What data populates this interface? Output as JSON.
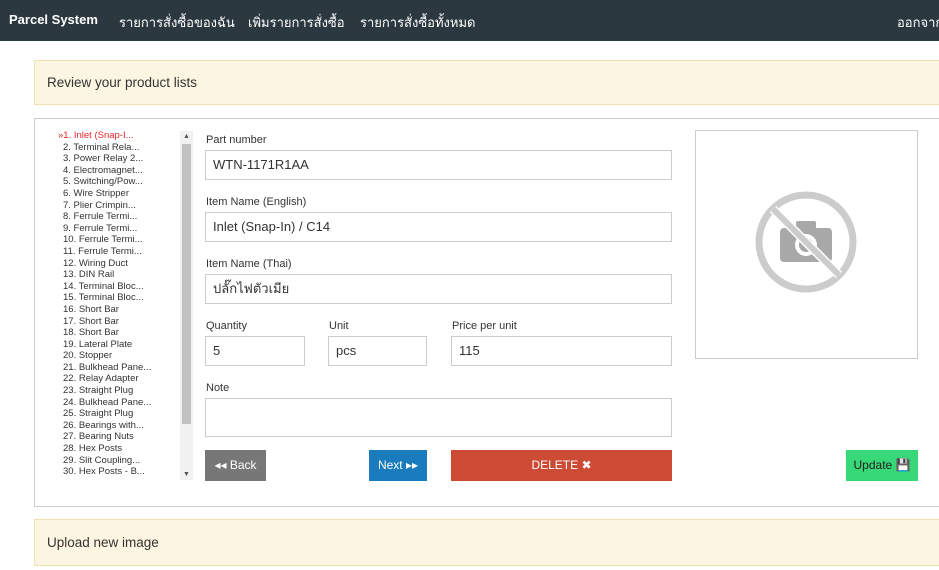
{
  "nav": {
    "brand": "Parcel System",
    "items": [
      "รายการสั่งซื้อของฉัน",
      "เพิ่มรายการสั่งซื้อ",
      "รายการสั่งซื้อทั้งหมด"
    ],
    "logout": "ออกจาก"
  },
  "review_panel": {
    "title": "Review your product lists"
  },
  "upload_panel": {
    "title": "Upload new image"
  },
  "product_list": {
    "active_marker": "»",
    "items": [
      "1. Inlet (Snap-I...",
      "2. Terminal Rela...",
      "3. Power Relay 2...",
      "4. Electromagnet...",
      "5. Switching/Pow...",
      "6. Wire Stripper",
      "7. Plier Crimpin...",
      "8. Ferrule Termi...",
      "9. Ferrule Termi...",
      "10. Ferrule Termi...",
      "11. Ferrule Termi...",
      "12. Wiring Duct",
      "13. DIN Rail",
      "14. Terminal Bloc...",
      "15. Terminal Bloc...",
      "16. Short Bar",
      "17. Short Bar",
      "18. Short Bar",
      "19. Lateral Plate",
      "20. Stopper",
      "21. Bulkhead Pane...",
      "22. Relay Adapter",
      "23. Straight Plug",
      "24. Bulkhead Pane...",
      "25. Straight Plug",
      "26. Bearings with...",
      "27. Bearing Nuts",
      "28. Hex Posts",
      "29. Slit Coupling...",
      "30. Hex Posts - B..."
    ]
  },
  "form": {
    "part_number": {
      "label": "Part number",
      "value": "WTN-1171R1AA"
    },
    "name_en": {
      "label": "Item Name (English)",
      "value": "Inlet (Snap-In) / C14"
    },
    "name_th": {
      "label": "Item Name (Thai)",
      "value": "ปลั๊กไฟตัวเมีย"
    },
    "quantity": {
      "label": "Quantity",
      "value": "5"
    },
    "unit": {
      "label": "Unit",
      "value": "pcs"
    },
    "price": {
      "label": "Price per unit",
      "value": "115"
    },
    "note": {
      "label": "Note",
      "value": ""
    }
  },
  "buttons": {
    "back": "◂◂ Back",
    "next": "Next ▸▸",
    "delete": "DELETE ✖",
    "update": "Update 💾"
  },
  "colors": {
    "nav": "#2c3840",
    "back": "#777777",
    "next": "#1a7bbd",
    "delete": "#cd4a35",
    "update": "#37d877"
  }
}
